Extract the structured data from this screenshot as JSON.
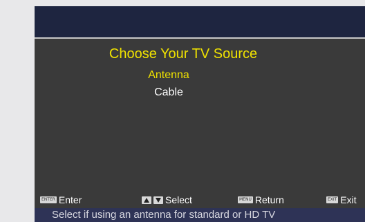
{
  "menu": {
    "title": "Choose Your TV Source",
    "options": [
      {
        "label": "Antenna",
        "selected": true
      },
      {
        "label": "Cable",
        "selected": false
      }
    ]
  },
  "footer": {
    "enter": {
      "key": "ENTER",
      "label": "Enter"
    },
    "select": {
      "key": "arrow-up-down-icon",
      "label": "Select"
    },
    "return": {
      "key": "MENU",
      "label": "Return"
    },
    "exit": {
      "key": "EXIT",
      "label": "Exit"
    }
  },
  "status": {
    "text": "Select if using an antenna for standard or HD TV"
  },
  "colors": {
    "highlight": "#f0e200",
    "background": "#3a3a3a",
    "header": "#1e2540",
    "status_bar": "#2e3356"
  }
}
